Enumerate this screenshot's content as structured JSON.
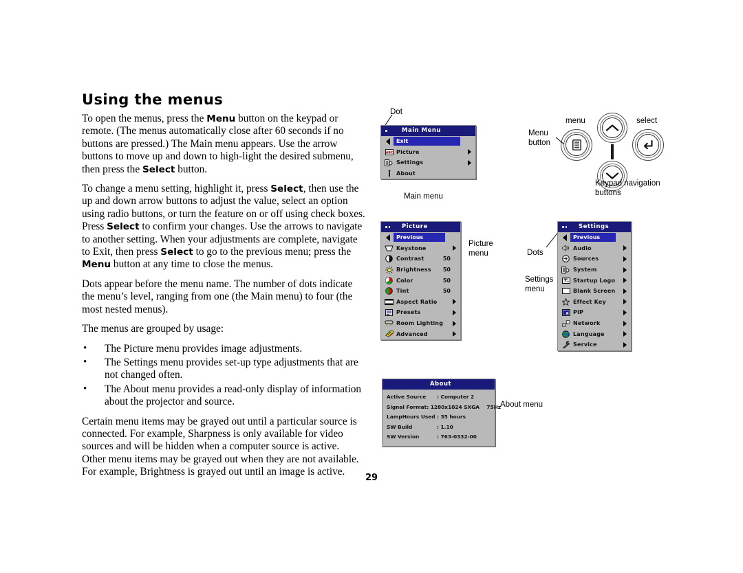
{
  "page": {
    "title": "Using the menus",
    "number": "29"
  },
  "body": {
    "paragraphs": [
      {
        "runs": [
          {
            "t": "To open the menus, press the "
          },
          {
            "t": "Menu",
            "b": true
          },
          {
            "t": " button on the keypad or remote. (The menus automatically close after 60 seconds if no buttons are pressed.) The Main menu appears. Use the arrow buttons to move up and down to high-light the desired submenu, then press the "
          },
          {
            "t": "Select",
            "b": true
          },
          {
            "t": " button."
          }
        ]
      },
      {
        "runs": [
          {
            "t": "To change a menu setting, highlight it, press "
          },
          {
            "t": "Select",
            "b": true
          },
          {
            "t": ", then use the up and down arrow buttons to adjust the value, select an option using radio buttons, or turn the feature on or off using check boxes. Press "
          },
          {
            "t": "Select",
            "b": true
          },
          {
            "t": " to confirm your changes. Use the arrows to navigate to another setting. When your adjustments are complete, navigate to Exit, then press "
          },
          {
            "t": "Select",
            "b": true
          },
          {
            "t": " to go to the previous menu; press the "
          },
          {
            "t": "Menu",
            "b": true
          },
          {
            "t": " button at any time to close the menus."
          }
        ]
      },
      {
        "runs": [
          {
            "t": "Dots appear before the menu name. The number of dots indicate the menu’s level, ranging from one (the Main menu) to four (the most nested menus)."
          }
        ]
      },
      {
        "runs": [
          {
            "t": "The menus are grouped by usage:"
          }
        ]
      }
    ],
    "bullets": [
      "The Picture menu provides image adjustments.",
      "The Settings menu provides set-up type adjustments that are not changed often.",
      "The About menu provides a read-only display of information about the projector and source."
    ],
    "closing": {
      "runs": [
        {
          "t": "Certain menu items may be grayed out until a particular source is connected. For example, Sharpness is only available for video sources and will be hidden when a computer source is active. Other menu items may be grayed out when they are not available. For example, Brightness is grayed out until an image is active."
        }
      ]
    }
  },
  "annotations": {
    "dot": "Dot",
    "main_menu": "Main menu",
    "picture_menu": "Picture\nmenu",
    "dots": "Dots",
    "settings_menu": "Settings\nmenu",
    "about_menu": "About menu",
    "menu_button": "Menu\nbutton",
    "menu_small": "menu",
    "select_small": "select",
    "keypad_nav": "Keypad navigation\nbuttons"
  },
  "main_menu": {
    "title": "Main Menu",
    "dots": 1,
    "items": [
      {
        "label": "Exit",
        "icon": "back-arrow-icon",
        "selected": true,
        "arrow": false
      },
      {
        "label": "Picture",
        "icon": "abc-picture-icon",
        "selected": false,
        "arrow": true
      },
      {
        "label": "Settings",
        "icon": "settings-hand-icon",
        "selected": false,
        "arrow": true
      },
      {
        "label": "About",
        "icon": "info-icon",
        "selected": false,
        "arrow": false
      }
    ]
  },
  "picture_menu": {
    "title": "Picture",
    "dots": 2,
    "items": [
      {
        "label": "Previous",
        "icon": "back-arrow-icon",
        "selected": true,
        "arrow": false,
        "value": ""
      },
      {
        "label": "Keystone",
        "icon": "keystone-icon",
        "selected": false,
        "arrow": true,
        "value": ""
      },
      {
        "label": "Contrast",
        "icon": "contrast-icon",
        "selected": false,
        "arrow": false,
        "value": "50"
      },
      {
        "label": "Brightness",
        "icon": "brightness-sun-icon",
        "selected": false,
        "arrow": false,
        "value": "50"
      },
      {
        "label": "Color",
        "icon": "color-wheel-icon",
        "selected": false,
        "arrow": false,
        "value": "50"
      },
      {
        "label": "Tint",
        "icon": "tint-icon",
        "selected": false,
        "arrow": false,
        "value": "50"
      },
      {
        "label": "Aspect Ratio",
        "icon": "aspect-ratio-icon",
        "selected": false,
        "arrow": true,
        "value": ""
      },
      {
        "label": "Presets",
        "icon": "presets-icon",
        "selected": false,
        "arrow": true,
        "value": ""
      },
      {
        "label": "Room Lighting",
        "icon": "room-lighting-icon",
        "selected": false,
        "arrow": true,
        "value": ""
      },
      {
        "label": "Advanced",
        "icon": "advanced-icon",
        "selected": false,
        "arrow": true,
        "value": ""
      }
    ]
  },
  "settings_menu": {
    "title": "Settings",
    "dots": 2,
    "items": [
      {
        "label": "Previous",
        "icon": "back-arrow-icon",
        "selected": true,
        "arrow": false
      },
      {
        "label": "Audio",
        "icon": "speaker-icon",
        "selected": false,
        "arrow": true
      },
      {
        "label": "Sources",
        "icon": "sources-icon",
        "selected": false,
        "arrow": true
      },
      {
        "label": "System",
        "icon": "system-icon",
        "selected": false,
        "arrow": true
      },
      {
        "label": "Startup Logo",
        "icon": "startup-logo-icon",
        "selected": false,
        "arrow": true
      },
      {
        "label": "Blank Screen",
        "icon": "blank-screen-icon",
        "selected": false,
        "arrow": true
      },
      {
        "label": "Effect Key",
        "icon": "star-icon",
        "selected": false,
        "arrow": true
      },
      {
        "label": "PiP",
        "icon": "pip-icon",
        "selected": false,
        "arrow": true
      },
      {
        "label": "Network",
        "icon": "network-icon",
        "selected": false,
        "arrow": true
      },
      {
        "label": "Language",
        "icon": "globe-icon",
        "selected": false,
        "arrow": true
      },
      {
        "label": "Service",
        "icon": "wrench-icon",
        "selected": false,
        "arrow": true
      }
    ]
  },
  "about_menu": {
    "title": "About",
    "rows": [
      {
        "key": "Active Source",
        "value": ": Computer 2"
      },
      {
        "key": "Signal Format",
        "value": ": 1280x1024 SXGA    75Hz"
      },
      {
        "key": "LampHours Used",
        "value": ": 35 hours"
      },
      {
        "key": "SW Build",
        "value": ": 1.10"
      },
      {
        "key": "SW Version",
        "value": ": 763-0332-00"
      }
    ]
  },
  "colors": {
    "osd_title_bg": "#1a1a7a",
    "osd_body_bg": "#b9b9b9",
    "osd_highlight": "#2727b4",
    "text": "#000000"
  }
}
